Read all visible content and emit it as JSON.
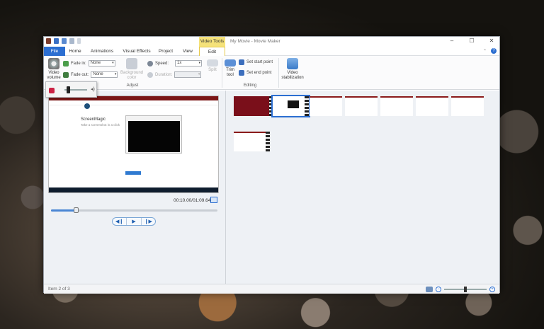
{
  "window": {
    "title": "My Movie - Movie Maker",
    "contextual_tab": "Video Tools"
  },
  "tabs": [
    "File",
    "Home",
    "Animations",
    "Visual Effects",
    "Project",
    "View",
    "Edit"
  ],
  "active_tab": "Edit",
  "ribbon": {
    "video_volume": "Video volume",
    "fade_in_label": "Fade in:",
    "fade_in_value": "None",
    "fade_out_label": "Fade out:",
    "fade_out_value": "None",
    "background_color": "Background color",
    "speed_label": "Speed:",
    "speed_value": "1x",
    "duration_label": "Duration:",
    "split": "Split",
    "adjust_group": "Adjust",
    "trim_tool": "Trim tool",
    "set_start_point": "Set start point",
    "set_end_point": "Set end point",
    "editing_group": "Editing",
    "video_stabilization": "Video stabilization"
  },
  "preview": {
    "timecode": "00:10.00/01:09.64",
    "progress_fraction": 0.15,
    "page_heading": "ScreenMagic",
    "page_subheading": "Take a screenshot in a click"
  },
  "playback": {
    "prev_icon": "previous-frame-icon",
    "play_icon": "play-icon",
    "next_icon": "next-frame-icon"
  },
  "status": {
    "item_text": "Item 2 of 3",
    "zoom_fraction": 0.5
  },
  "colors": {
    "accent": "#2b6ed1",
    "contextual": "#f5e27a",
    "clip_red": "#7a0f1a"
  }
}
